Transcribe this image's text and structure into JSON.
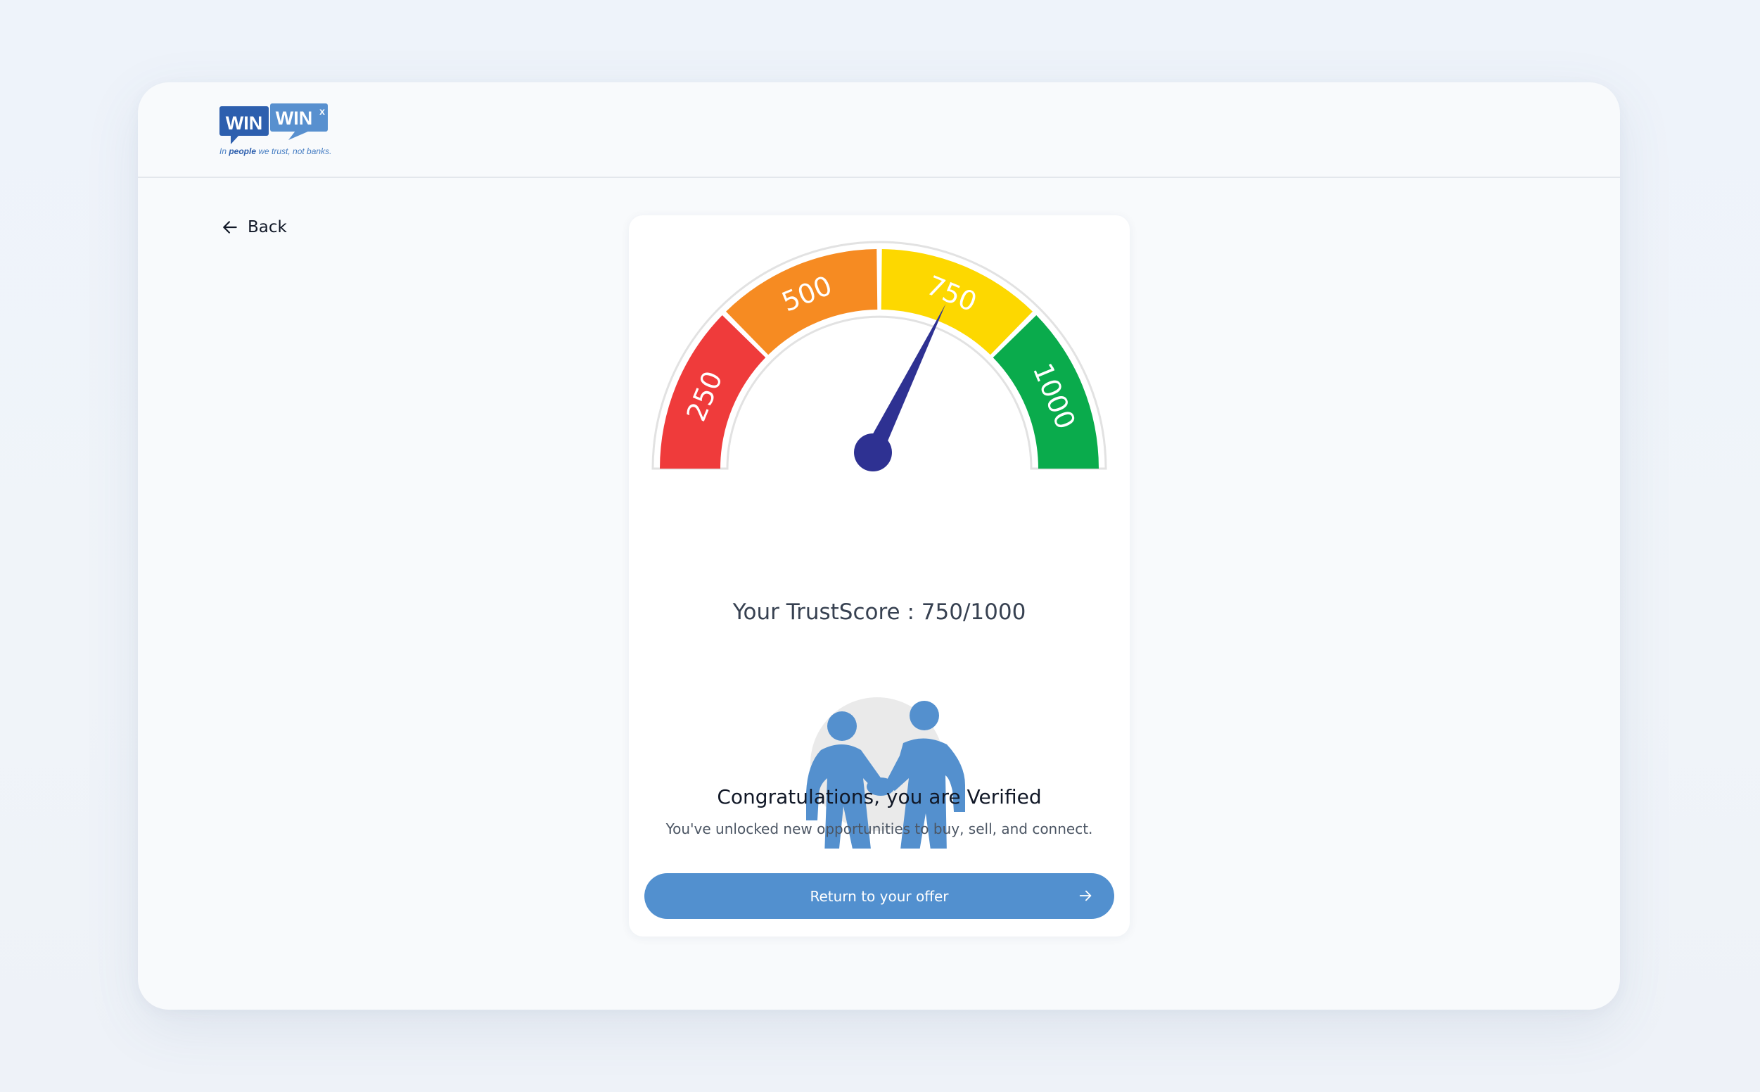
{
  "brand": {
    "logo_word_1": "WIN",
    "logo_word_2": "WIN",
    "logo_mark": "x",
    "tagline_1": "In ",
    "tagline_2": "people",
    "tagline_3": " we trust, not banks.",
    "tagline_tm": "™"
  },
  "nav": {
    "back_label": "Back",
    "back_icon": "arrow-left-icon"
  },
  "gauge": {
    "min": 0,
    "max": 1000,
    "value": 750,
    "segments": [
      {
        "label": "250",
        "color": "#ef3b3b"
      },
      {
        "label": "500",
        "color": "#f68b22"
      },
      {
        "label": "750",
        "color": "#fdd800"
      },
      {
        "label": "1000",
        "color": "#0aab4c"
      }
    ],
    "needle_color": "#2e3192"
  },
  "score": {
    "prefix": "Your TrustScore : ",
    "value": "750/1000"
  },
  "message": {
    "title": "Congratulations, you are Verified",
    "subtitle": "You've unlocked new opportunities to buy, sell, and connect."
  },
  "cta": {
    "label": "Return to your offer",
    "icon": "arrow-right-icon",
    "color": "#5290cf"
  },
  "illustration": {
    "icon": "people-handshake-icon",
    "figure_color": "#5490ce"
  }
}
